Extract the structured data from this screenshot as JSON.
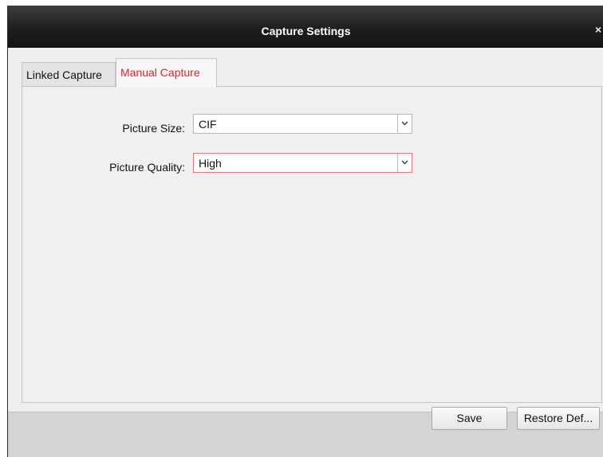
{
  "window": {
    "title": "Capture Settings",
    "close_glyph": "×"
  },
  "tabs": [
    {
      "label": "Linked Capture",
      "active": false
    },
    {
      "label": "Manual Capture",
      "active": true
    }
  ],
  "form": {
    "picture_size": {
      "label": "Picture Size:",
      "value": "CIF"
    },
    "picture_quality": {
      "label": "Picture Quality:",
      "value": "High"
    }
  },
  "buttons": {
    "save": "Save",
    "restore_default": "Restore Def..."
  },
  "colors": {
    "active_tab_text": "#d8282f",
    "titlebar": "#1e1e1e",
    "focus_border": "#e07a7a"
  },
  "icons": {
    "close": "close-icon",
    "dropdown": "chevron-down-icon"
  }
}
